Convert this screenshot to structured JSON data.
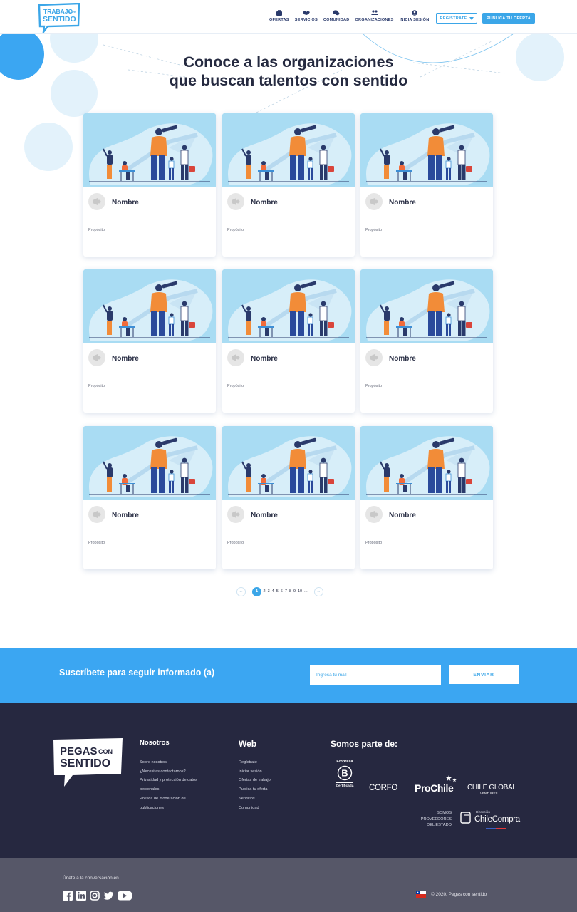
{
  "header": {
    "logo_line1": "TRABAJO",
    "logo_line1b": "CON",
    "logo_line2": "SENTIDO",
    "nav": [
      {
        "label": "OFERTAS",
        "icon": "briefcase-icon"
      },
      {
        "label": "SERVICIOS",
        "icon": "handshake-icon"
      },
      {
        "label": "COMUNIDAD",
        "icon": "chat-bubbles-icon"
      },
      {
        "label": "ORGANIZACIONES",
        "icon": "people-icon"
      },
      {
        "label": "INICIA SESIÓN",
        "icon": "user-circle-icon"
      }
    ],
    "register_label": "REGÍSTRATE",
    "publish_label": "PUBLICA TU OFERTA"
  },
  "hero": {
    "title_line1": "Conoce a las organizaciones",
    "title_line2": "que buscan talentos con sentido"
  },
  "cards": [
    {
      "name": "Nombre",
      "purpose": "Propósito"
    },
    {
      "name": "Nombre",
      "purpose": "Propósito"
    },
    {
      "name": "Nombre",
      "purpose": "Propósito"
    },
    {
      "name": "Nombre",
      "purpose": "Propósito"
    },
    {
      "name": "Nombre",
      "purpose": "Propósito"
    },
    {
      "name": "Nombre",
      "purpose": "Propósito"
    },
    {
      "name": "Nombre",
      "purpose": "Propósito"
    },
    {
      "name": "Nombre",
      "purpose": "Propósito"
    },
    {
      "name": "Nombre",
      "purpose": "Propósito"
    }
  ],
  "pagination": {
    "prev": "←",
    "next": "→",
    "current": "1",
    "pages": [
      "2",
      "3",
      "4",
      "5",
      "6",
      "7",
      "8",
      "9",
      "10",
      "..."
    ]
  },
  "subscribe": {
    "title": "Suscríbete para seguir informado (a)",
    "placeholder": "Ingresa tu mail",
    "button": "ENVIAR"
  },
  "footer": {
    "logo_line1": "PEGAS",
    "logo_line1b": "CON",
    "logo_line2": "SENTIDO",
    "nosotros_title": "Nosotros",
    "nosotros_links": [
      "Sobre nosotros",
      "¿Necesitas contactarnos?",
      "Privacidad y protección de datos",
      "personales",
      "Política de moderación de",
      "publicaciones"
    ],
    "web_title": "Web",
    "web_links": [
      "Regístrate",
      "Iniciar sesión",
      "Ofertas de trabajo",
      "Publica tu oferta",
      "Servicios",
      "Comunidad"
    ],
    "partners_title": "Somos parte de:",
    "bcorp_top": "Empresa",
    "bcorp_bottom": "Certificada",
    "corfo": "CORFO",
    "prochile": "ProChile",
    "chileglobal": "CHILE GLOBAL",
    "chileglobal_sub": "VENTURES",
    "proveedores": [
      "SOMOS",
      "PROVEEDORES",
      "DEL ESTADO"
    ],
    "chilecompra_small": "Dirección",
    "chilecompra": "ChileCompra"
  },
  "bottom": {
    "join_text": "Únete a la conversación en..",
    "socials": [
      "facebook-icon",
      "linkedin-icon",
      "instagram-icon",
      "twitter-icon",
      "youtube-icon"
    ],
    "copyright": "© 2020, Pegas con sentido"
  },
  "colors": {
    "accent": "#3ba6e8",
    "navy": "#262840",
    "card_image_bg": "#a9dcf3"
  }
}
